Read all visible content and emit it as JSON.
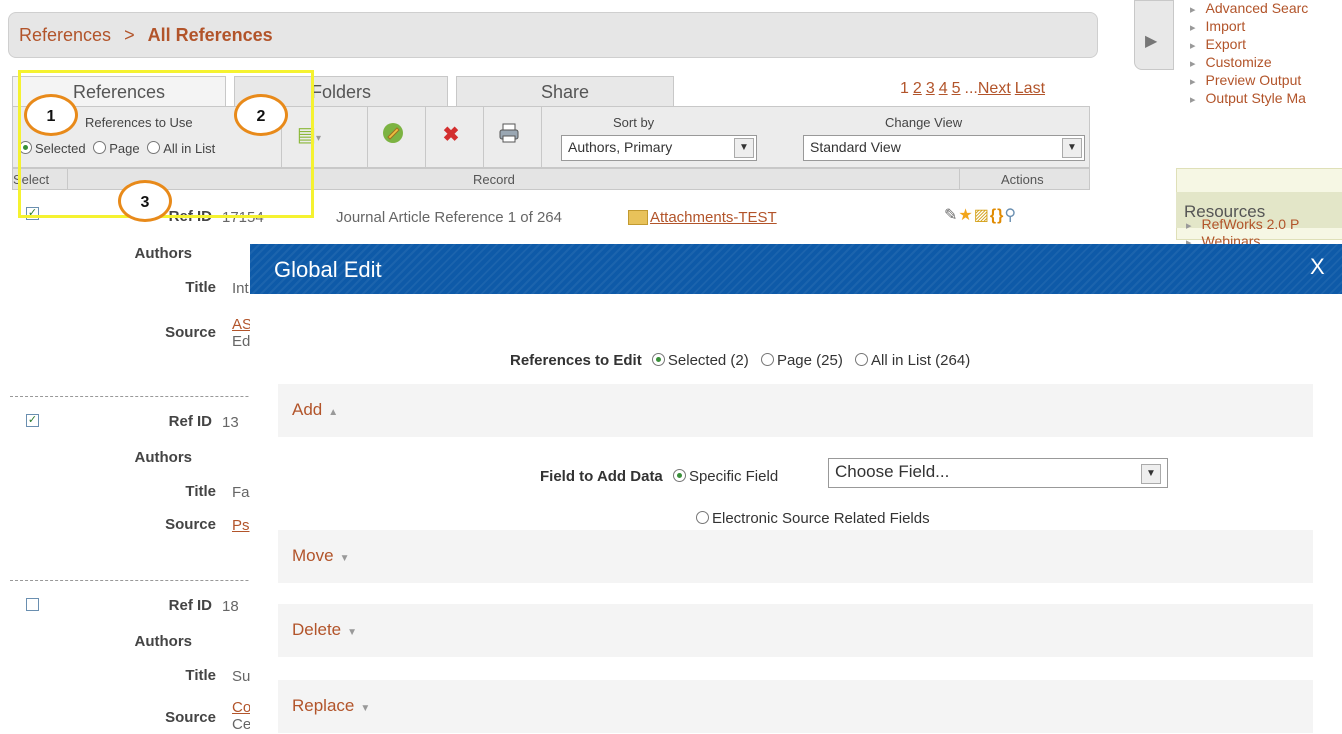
{
  "breadcrumb": {
    "root": "References",
    "sep": ">",
    "current": "All References"
  },
  "tabs": [
    {
      "label": "References"
    },
    {
      "label": "Folders"
    },
    {
      "label": "Share"
    }
  ],
  "pager": {
    "current": "1",
    "pages": [
      "2",
      "3",
      "4",
      "5"
    ],
    "ellipsis": "...",
    "next": "Next",
    "last": "Last"
  },
  "toolbar": {
    "refs_to_use_label": "References to Use",
    "opt_selected": "Selected",
    "opt_page": "Page",
    "opt_all": "All in List",
    "sort_label": "Sort by",
    "sort_value": "Authors, Primary",
    "view_label": "Change View",
    "view_value": "Standard View"
  },
  "columns": {
    "select": "Select",
    "record": "Record",
    "actions": "Actions"
  },
  "callouts": {
    "c1": "1",
    "c2": "2",
    "c3": "3"
  },
  "records": [
    {
      "checked": true,
      "ref_label": "Ref ID",
      "ref_id": "17154",
      "ref_type": "Journal Article Reference 1 of 264",
      "attachment": "Attachments-TEST",
      "authors_label": "Authors",
      "title_label": "Title",
      "title_val": "Int",
      "source_label": "Source",
      "source_val": "AS",
      "source_val2": "Ed"
    },
    {
      "checked": true,
      "ref_label": "Ref ID",
      "ref_id": "13",
      "authors_label": "Authors",
      "title_label": "Title",
      "title_val": "Fa",
      "source_label": "Source",
      "source_val": "Ps"
    },
    {
      "checked": false,
      "ref_label": "Ref ID",
      "ref_id": "18",
      "authors_label": "Authors",
      "title_label": "Title",
      "title_val": "Su",
      "source_label": "Source",
      "source_val": "Co",
      "source_val2": "Ce"
    }
  ],
  "sidebar": {
    "links": [
      "Advanced Searc",
      "Import",
      "Export",
      "Customize",
      "Preview Output",
      "Output Style Ma"
    ],
    "resources_title": "Resources",
    "resource_links": [
      "RefWorks 2.0 P",
      "Webinars"
    ]
  },
  "modal": {
    "title": "Global Edit",
    "close": "X",
    "refs_to_edit_label": "References to Edit",
    "opt_selected": "Selected (2)",
    "opt_page": "Page (25)",
    "opt_all": "All in List (264)",
    "sections": {
      "add": "Add",
      "move": "Move",
      "delete": "Delete",
      "replace": "Replace"
    },
    "field_to_add_label": "Field to Add Data",
    "opt_specific": "Specific Field",
    "choose_field": "Choose Field...",
    "opt_esrf": "Electronic Source Related Fields"
  },
  "colors": {
    "accent": "#b2542a",
    "modal_header": "#0e5aa8",
    "highlight": "#f5f230",
    "callout": "#e88a1a"
  }
}
